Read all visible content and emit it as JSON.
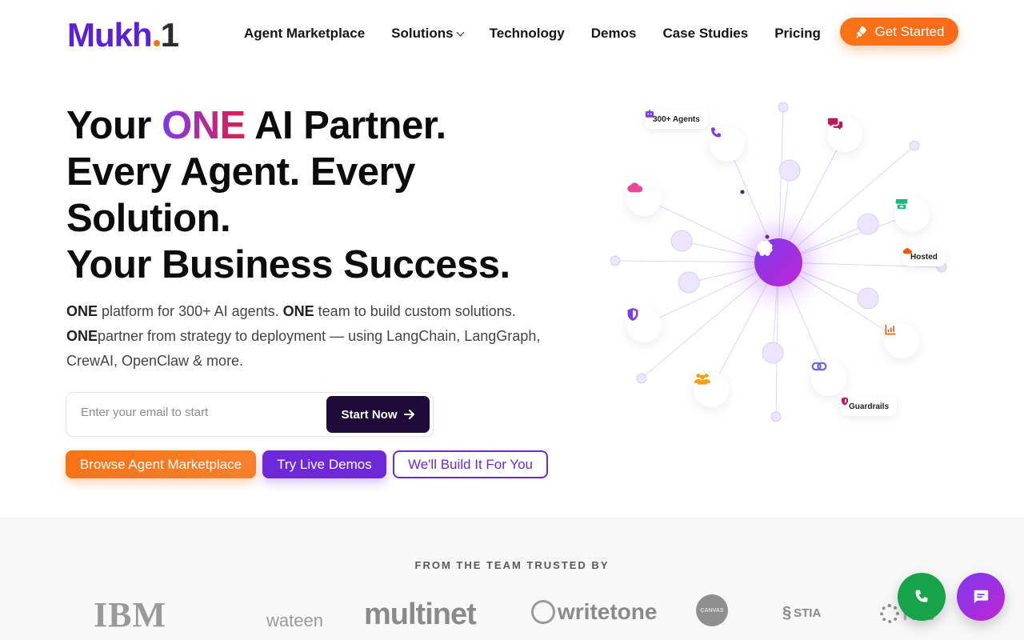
{
  "brand": {
    "logo_text_main": "Mukh",
    "logo_text_suffix": "1",
    "accent": "#5b21d6",
    "orange": "#f97316"
  },
  "nav": {
    "items": [
      {
        "label": "Agent Marketplace"
      },
      {
        "label": "Solutions",
        "dropdown": true
      },
      {
        "label": "Technology"
      },
      {
        "label": "Demos"
      },
      {
        "label": "Case Studies"
      },
      {
        "label": "Pricing"
      }
    ],
    "cta_label": "Get Started",
    "cta_icon": "rocket-icon"
  },
  "hero": {
    "title_line1_pre": "Your ",
    "title_line1_highlight": "ONE",
    "title_line1_post": " AI Partner.",
    "title_line2": "Every Agent. Every",
    "title_line3": "Solution.",
    "title_line4": "Your Business Success.",
    "sub_b1": "ONE",
    "sub_t1": " platform for 300+ AI agents. ",
    "sub_b2": "ONE",
    "sub_t2": " team to build custom solutions.",
    "sub_b3": "ONE",
    "sub_t3": "partner from strategy to deployment — using LangChain, LangGraph, CrewAI, OpenClaw & more."
  },
  "email_form": {
    "placeholder": "Enter your email to start",
    "button_label": "Start Now"
  },
  "ctas": {
    "marketplace": "Browse Agent Marketplace",
    "demos": "Try Live Demos",
    "build": "We'll Build It For You"
  },
  "graphic": {
    "pills": {
      "agents": "300+ Agents",
      "hosted": "Hosted",
      "guardrails": "Guardrails"
    },
    "icons": [
      "brain-icon",
      "phone-icon",
      "chat-icon",
      "cloud-icon",
      "store-icon",
      "shield-icon",
      "chart-icon",
      "users-icon",
      "link-icon"
    ]
  },
  "trusted": {
    "label": "FROM THE TEAM TRUSTED BY",
    "logos": [
      "IBM",
      "wateen",
      "multinet",
      "writetone",
      "CANVAS",
      "STIA",
      "NW"
    ]
  },
  "fabs": {
    "call_icon": "phone-icon",
    "chat_icon": "chat-icon"
  }
}
